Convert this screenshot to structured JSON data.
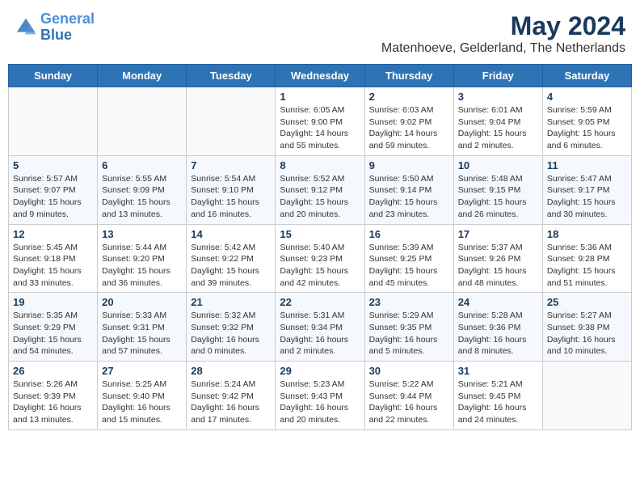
{
  "header": {
    "logo_line1": "General",
    "logo_line2": "Blue",
    "title": "May 2024",
    "subtitle": "Matenhoeve, Gelderland, The Netherlands"
  },
  "weekdays": [
    "Sunday",
    "Monday",
    "Tuesday",
    "Wednesday",
    "Thursday",
    "Friday",
    "Saturday"
  ],
  "weeks": [
    [
      {
        "day": "",
        "info": ""
      },
      {
        "day": "",
        "info": ""
      },
      {
        "day": "",
        "info": ""
      },
      {
        "day": "1",
        "info": "Sunrise: 6:05 AM\nSunset: 9:00 PM\nDaylight: 14 hours\nand 55 minutes."
      },
      {
        "day": "2",
        "info": "Sunrise: 6:03 AM\nSunset: 9:02 PM\nDaylight: 14 hours\nand 59 minutes."
      },
      {
        "day": "3",
        "info": "Sunrise: 6:01 AM\nSunset: 9:04 PM\nDaylight: 15 hours\nand 2 minutes."
      },
      {
        "day": "4",
        "info": "Sunrise: 5:59 AM\nSunset: 9:05 PM\nDaylight: 15 hours\nand 6 minutes."
      }
    ],
    [
      {
        "day": "5",
        "info": "Sunrise: 5:57 AM\nSunset: 9:07 PM\nDaylight: 15 hours\nand 9 minutes."
      },
      {
        "day": "6",
        "info": "Sunrise: 5:55 AM\nSunset: 9:09 PM\nDaylight: 15 hours\nand 13 minutes."
      },
      {
        "day": "7",
        "info": "Sunrise: 5:54 AM\nSunset: 9:10 PM\nDaylight: 15 hours\nand 16 minutes."
      },
      {
        "day": "8",
        "info": "Sunrise: 5:52 AM\nSunset: 9:12 PM\nDaylight: 15 hours\nand 20 minutes."
      },
      {
        "day": "9",
        "info": "Sunrise: 5:50 AM\nSunset: 9:14 PM\nDaylight: 15 hours\nand 23 minutes."
      },
      {
        "day": "10",
        "info": "Sunrise: 5:48 AM\nSunset: 9:15 PM\nDaylight: 15 hours\nand 26 minutes."
      },
      {
        "day": "11",
        "info": "Sunrise: 5:47 AM\nSunset: 9:17 PM\nDaylight: 15 hours\nand 30 minutes."
      }
    ],
    [
      {
        "day": "12",
        "info": "Sunrise: 5:45 AM\nSunset: 9:18 PM\nDaylight: 15 hours\nand 33 minutes."
      },
      {
        "day": "13",
        "info": "Sunrise: 5:44 AM\nSunset: 9:20 PM\nDaylight: 15 hours\nand 36 minutes."
      },
      {
        "day": "14",
        "info": "Sunrise: 5:42 AM\nSunset: 9:22 PM\nDaylight: 15 hours\nand 39 minutes."
      },
      {
        "day": "15",
        "info": "Sunrise: 5:40 AM\nSunset: 9:23 PM\nDaylight: 15 hours\nand 42 minutes."
      },
      {
        "day": "16",
        "info": "Sunrise: 5:39 AM\nSunset: 9:25 PM\nDaylight: 15 hours\nand 45 minutes."
      },
      {
        "day": "17",
        "info": "Sunrise: 5:37 AM\nSunset: 9:26 PM\nDaylight: 15 hours\nand 48 minutes."
      },
      {
        "day": "18",
        "info": "Sunrise: 5:36 AM\nSunset: 9:28 PM\nDaylight: 15 hours\nand 51 minutes."
      }
    ],
    [
      {
        "day": "19",
        "info": "Sunrise: 5:35 AM\nSunset: 9:29 PM\nDaylight: 15 hours\nand 54 minutes."
      },
      {
        "day": "20",
        "info": "Sunrise: 5:33 AM\nSunset: 9:31 PM\nDaylight: 15 hours\nand 57 minutes."
      },
      {
        "day": "21",
        "info": "Sunrise: 5:32 AM\nSunset: 9:32 PM\nDaylight: 16 hours\nand 0 minutes."
      },
      {
        "day": "22",
        "info": "Sunrise: 5:31 AM\nSunset: 9:34 PM\nDaylight: 16 hours\nand 2 minutes."
      },
      {
        "day": "23",
        "info": "Sunrise: 5:29 AM\nSunset: 9:35 PM\nDaylight: 16 hours\nand 5 minutes."
      },
      {
        "day": "24",
        "info": "Sunrise: 5:28 AM\nSunset: 9:36 PM\nDaylight: 16 hours\nand 8 minutes."
      },
      {
        "day": "25",
        "info": "Sunrise: 5:27 AM\nSunset: 9:38 PM\nDaylight: 16 hours\nand 10 minutes."
      }
    ],
    [
      {
        "day": "26",
        "info": "Sunrise: 5:26 AM\nSunset: 9:39 PM\nDaylight: 16 hours\nand 13 minutes."
      },
      {
        "day": "27",
        "info": "Sunrise: 5:25 AM\nSunset: 9:40 PM\nDaylight: 16 hours\nand 15 minutes."
      },
      {
        "day": "28",
        "info": "Sunrise: 5:24 AM\nSunset: 9:42 PM\nDaylight: 16 hours\nand 17 minutes."
      },
      {
        "day": "29",
        "info": "Sunrise: 5:23 AM\nSunset: 9:43 PM\nDaylight: 16 hours\nand 20 minutes."
      },
      {
        "day": "30",
        "info": "Sunrise: 5:22 AM\nSunset: 9:44 PM\nDaylight: 16 hours\nand 22 minutes."
      },
      {
        "day": "31",
        "info": "Sunrise: 5:21 AM\nSunset: 9:45 PM\nDaylight: 16 hours\nand 24 minutes."
      },
      {
        "day": "",
        "info": ""
      }
    ]
  ]
}
